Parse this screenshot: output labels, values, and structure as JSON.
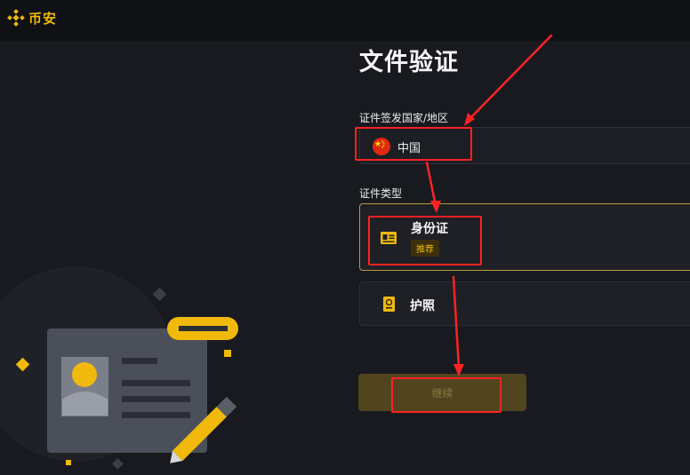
{
  "header": {
    "logo_text": "币安",
    "brand_color": "#f0b90b",
    "logo_icon": "binance-diamond-icon"
  },
  "page": {
    "title": "文件验证"
  },
  "country_field": {
    "label": "证件签发国家/地区",
    "value": "中国",
    "flag_icon": "china-flag-icon"
  },
  "doc_type": {
    "label": "证件类型",
    "options": [
      {
        "label": "身份证",
        "badge": "推荐",
        "icon": "id-card-icon",
        "selected": true
      },
      {
        "label": "护照",
        "icon": "passport-icon",
        "selected": false
      }
    ]
  },
  "continue_button": {
    "label": "继续"
  },
  "annotations": {
    "highlight_color": "#ff2222"
  },
  "illustration": {
    "icon": "id-card-illustration"
  }
}
